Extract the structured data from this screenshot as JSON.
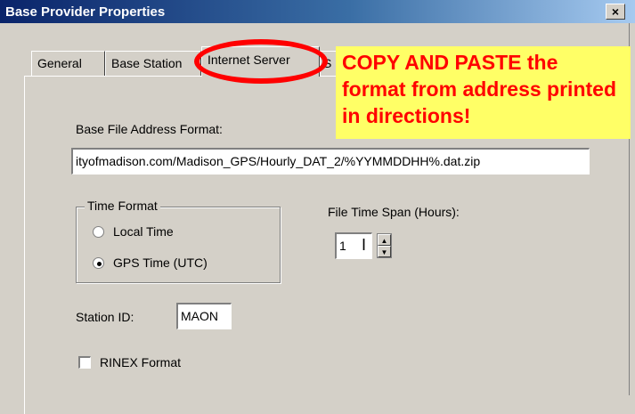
{
  "window": {
    "title": "Base Provider Properties",
    "close_label": "×"
  },
  "tabs": [
    {
      "label": "General"
    },
    {
      "label": "Base Station"
    },
    {
      "label": "Internet Server",
      "active": true
    },
    {
      "label": "S"
    }
  ],
  "form": {
    "base_file_address_label": "Base File Address Format:",
    "base_file_address_value": "ityofmadison.com/Madison_GPS/Hourly_DAT_2/%YYMMDDHH%.dat.zip",
    "time_format_legend": "Time Format",
    "time_options": [
      {
        "label": "Local Time",
        "selected": false
      },
      {
        "label": "GPS Time (UTC)",
        "selected": true
      }
    ],
    "file_time_span_label": "File Time Span (Hours):",
    "file_time_span_value": "1",
    "station_id_label": "Station ID:",
    "station_id_value": "MAON",
    "rinex_label": "RINEX Format",
    "rinex_checked": false
  },
  "annotation": {
    "highlight_text": "COPY AND PASTE",
    "rest_text": " the format from address printed in directions!",
    "color": "#ff0000",
    "background": "#ffff66"
  }
}
